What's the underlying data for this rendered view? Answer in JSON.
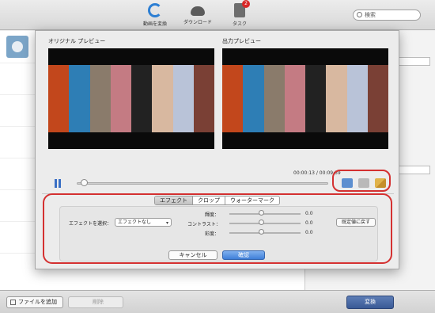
{
  "toolbar": {
    "convert_label": "動画を変換",
    "download_label": "ダウンロード",
    "task_label": "タスク",
    "task_badge": "2",
    "search_placeholder": "検索"
  },
  "dialog": {
    "original_preview_label": "オリジナル プレビュー",
    "output_preview_label": "出力プレビュー",
    "timecode": "00:00:13 / 00:09:59",
    "tabs": [
      {
        "label": "エフェクト",
        "active": true
      },
      {
        "label": "クロップ",
        "active": false
      },
      {
        "label": "ウォーターマーク",
        "active": false
      }
    ],
    "effect_select_label": "エフェクトを選択：",
    "effect_select_value": "エフェクトなし",
    "brightness_label": "輝度：",
    "brightness_value": "0.0",
    "contrast_label": "コントラスト：",
    "contrast_value": "0.0",
    "saturation_label": "彩度：",
    "saturation_value": "0.0",
    "reset_label": "既定値に戻す",
    "cancel_label": "キャンセル",
    "ok_label": "確認"
  },
  "bottom": {
    "add_file_label": "ファイルを追加",
    "delete_label": "削除",
    "convert_label": "変換"
  },
  "colors": {
    "highlight": "#d43030",
    "accent": "#3f7fd8",
    "convert_button": "#3a5a96"
  },
  "icons": [
    "convert-icon",
    "download-icon",
    "task-icon",
    "search-icon",
    "pause-icon",
    "crop-tool-icon",
    "eraser-tool-icon",
    "brush-tool-icon",
    "add-icon",
    "play-icon"
  ]
}
